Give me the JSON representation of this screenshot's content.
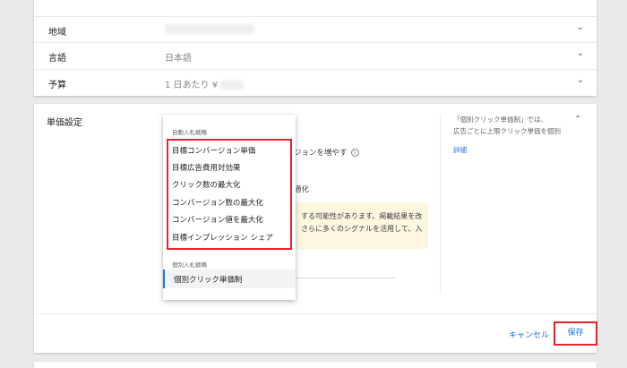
{
  "settings": {
    "rows": [
      {
        "label": "地域",
        "value": "",
        "chevron": "⌄"
      },
      {
        "label": "言語",
        "value": "日本語",
        "chevron": "⌄"
      },
      {
        "label": "予算",
        "value": "1 日あたり ¥",
        "chevron": "⌄"
      }
    ]
  },
  "bidding": {
    "section_title": "単価設定",
    "behind_text_1": "ジョンを増やす",
    "help_icon": "?",
    "behind_text_2": "適化",
    "warning_line_1": "する可能性があります。掲載結果を改",
    "warning_line_2": "さらに多くのシグナルを活用して、入",
    "side_help_1": "「個別クリック単価制」では、",
    "side_help_2": "広告ごとに上限クリック単価を個別",
    "side_link": "詳細",
    "collapse_icon": "⌃"
  },
  "dropdown": {
    "auto_group_label": "自動入札戦略",
    "auto_options": [
      "目標コンバージョン単価",
      "目標広告費用対効果",
      "クリック数の最大化",
      "コンバージョン数の最大化",
      "コンバージョン値を最大化",
      "目標インプレッション シェア"
    ],
    "manual_group_label": "個別入札戦略",
    "manual_option": "個別クリック単価制"
  },
  "actions": {
    "cancel_label": "キャンセル",
    "save_label": "保存"
  },
  "colors": {
    "accent": "#1a73e8",
    "highlight_red": "#e8232a",
    "warning_bg": "#fef7e0"
  }
}
